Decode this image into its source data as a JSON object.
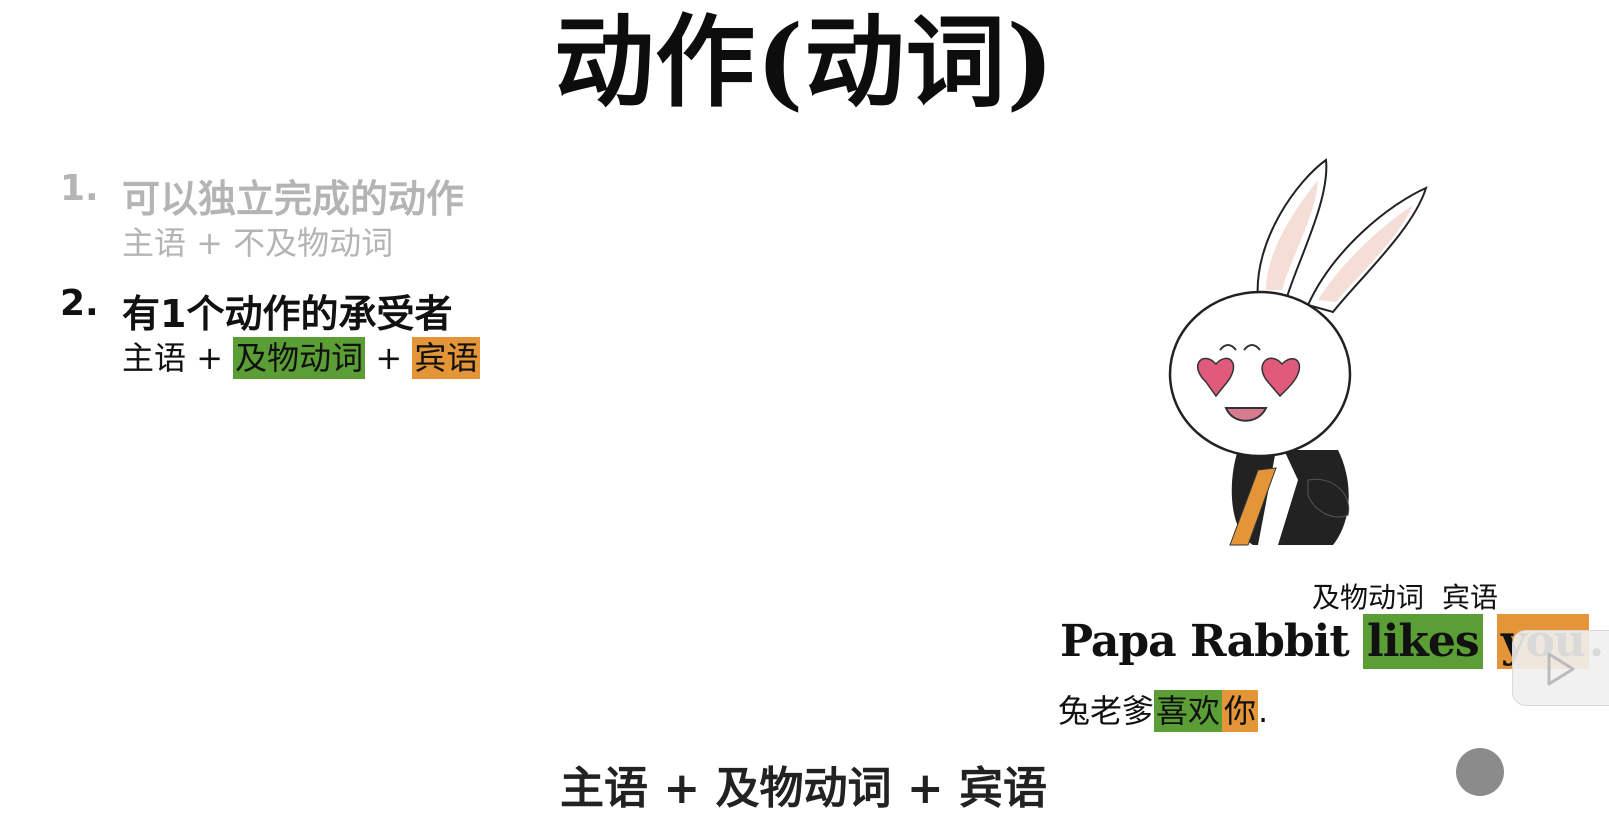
{
  "title": "动作(动词)",
  "items": [
    {
      "number": "1.",
      "heading": "可以独立完成的动作",
      "formula": "主语 + 不及物动词"
    },
    {
      "number": "2.",
      "heading": "有1个动作的承受者",
      "formula": {
        "subject": "主语",
        "plus1": " + ",
        "verb": "及物动词",
        "plus2": " + ",
        "object": "宾语"
      }
    }
  ],
  "example": {
    "role_labels": {
      "verb": "及物动词",
      "object": "宾语"
    },
    "sentence": {
      "pre": "Papa Rabbit ",
      "verb": "likes",
      "space": " ",
      "object": "you",
      "end": "."
    },
    "translation": {
      "pre": "兔老爹",
      "verb": "喜欢",
      "object": "你",
      "end": "."
    }
  },
  "bottom_partial_text": "主语 + 及物动词 + 宾语",
  "colors": {
    "verb_highlight": "#5a9e35",
    "object_highlight": "#e39537",
    "faded_text": "#b4b4b4"
  },
  "icons": [
    "rabbit-mascot-illustration",
    "play-icon"
  ]
}
